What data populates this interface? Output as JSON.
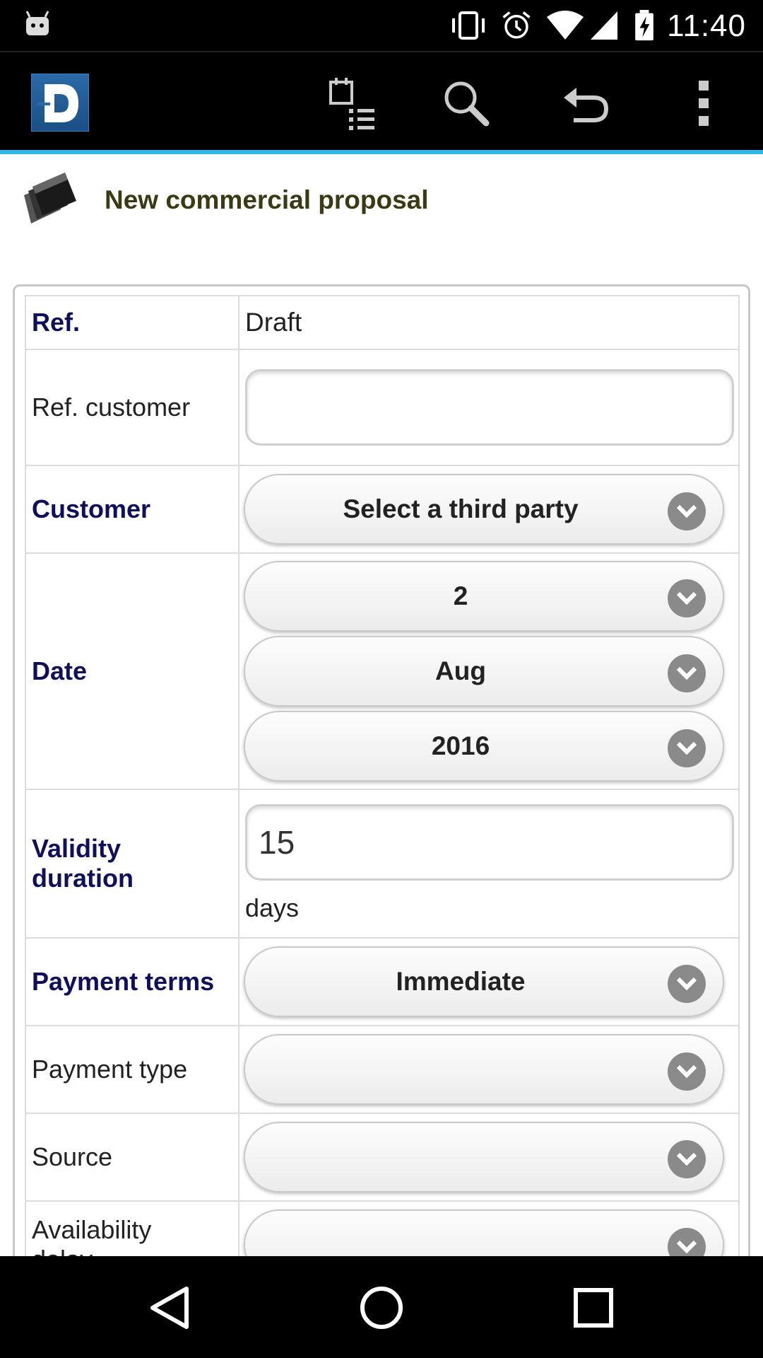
{
  "status_bar": {
    "time": "11:40",
    "icons": [
      "android-icon",
      "vibrate-icon",
      "alarm-icon",
      "wifi-icon",
      "signal-icon",
      "battery-charging-icon"
    ]
  },
  "action_bar": {
    "logo_letter": "D",
    "buttons": [
      "agenda-list-icon",
      "search-icon",
      "back-arrow-icon",
      "overflow-menu-icon"
    ],
    "accent_color": "#33b5e5"
  },
  "page": {
    "title": "New commercial proposal",
    "icon": "folder-icon"
  },
  "form": {
    "ref_label": "Ref.",
    "ref_value": "Draft",
    "ref_customer_label": "Ref. customer",
    "ref_customer_value": "",
    "customer_label": "Customer",
    "customer_value": "Select a third party",
    "date_label": "Date",
    "date_day": "2",
    "date_month": "Aug",
    "date_year": "2016",
    "validity_label_line1": "Validity",
    "validity_label_line2": "duration",
    "validity_value": "15",
    "validity_unit": "days",
    "payment_terms_label": "Payment terms",
    "payment_terms_value": "Immediate",
    "payment_type_label": "Payment type",
    "payment_type_value": "",
    "source_label": "Source",
    "source_value": "",
    "availability_label_line1": "Availability",
    "availability_label_line2": "delay",
    "availability_value": ""
  },
  "nav_bar": {
    "buttons": [
      "nav-back-icon",
      "nav-home-icon",
      "nav-recents-icon"
    ]
  }
}
